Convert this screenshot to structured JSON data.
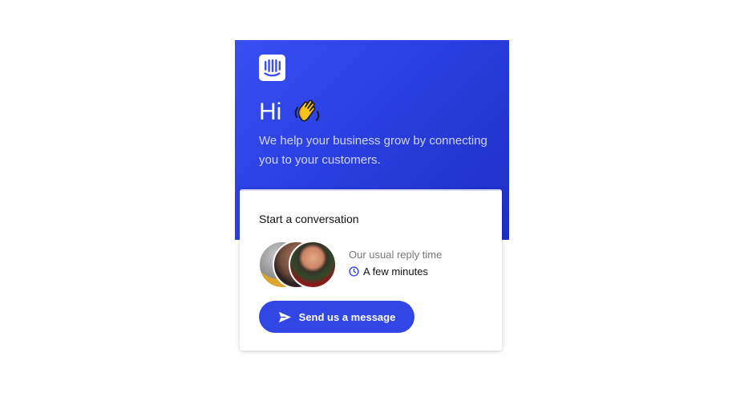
{
  "header": {
    "greeting": "Hi",
    "emoji": "👋",
    "intro": "We help your business grow by connecting you to your customers."
  },
  "card": {
    "title": "Start a conversation",
    "reply_label": "Our usual reply time",
    "reply_value": "A few minutes",
    "send_label": "Send us a message"
  },
  "icons": {
    "logo": "intercom-logo-icon",
    "wave": "waving-hand-icon",
    "clock": "clock-icon",
    "send": "send-icon"
  },
  "colors": {
    "header_start": "#3a4ff0",
    "header_end": "#1f2fc4",
    "button": "#3246e6",
    "clock": "#2f44d8"
  }
}
